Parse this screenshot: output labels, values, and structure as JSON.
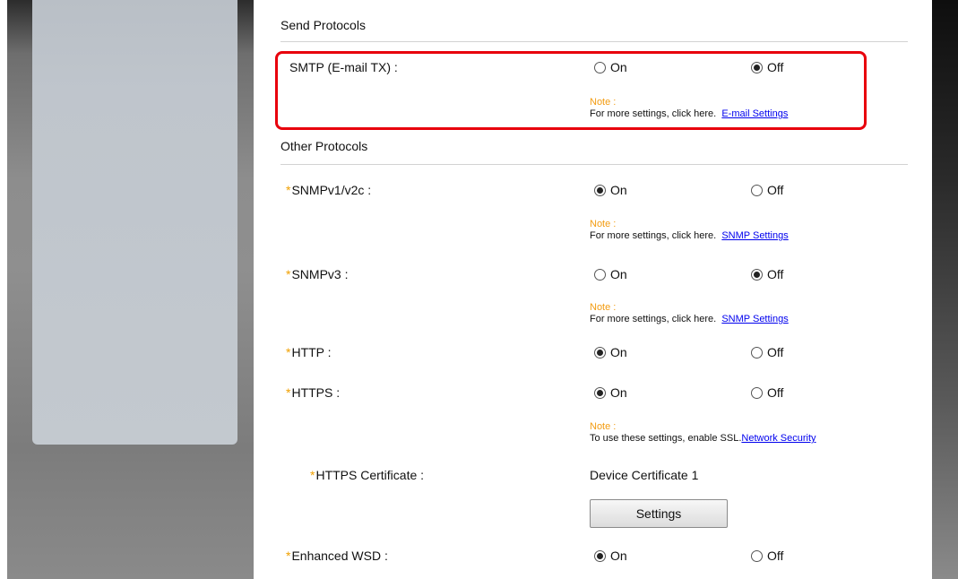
{
  "send_protocols": {
    "title": "Send Protocols",
    "smtp": {
      "label": "SMTP (E-mail TX) :",
      "on_label": "On",
      "off_label": "Off",
      "selected": "off",
      "note_title": "Note :",
      "note_text": "For more settings, click here.",
      "note_link": "E-mail Settings"
    }
  },
  "other_protocols": {
    "title": "Other Protocols",
    "required_mark": "*",
    "snmpv1": {
      "label": "SNMPv1/v2c :",
      "on_label": "On",
      "off_label": "Off",
      "selected": "on",
      "note_title": "Note :",
      "note_text": "For more settings, click here.",
      "note_link": "SNMP Settings"
    },
    "snmpv3": {
      "label": "SNMPv3 :",
      "on_label": "On",
      "off_label": "Off",
      "selected": "off",
      "note_title": "Note :",
      "note_text": "For more settings, click here.",
      "note_link": "SNMP Settings"
    },
    "http": {
      "label": "HTTP :",
      "on_label": "On",
      "off_label": "Off",
      "selected": "on"
    },
    "https": {
      "label": "HTTPS :",
      "on_label": "On",
      "off_label": "Off",
      "selected": "on",
      "note_title": "Note :",
      "note_text": "To use these settings, enable SSL.",
      "note_link": "Network Security"
    },
    "https_certificate": {
      "label": "HTTPS Certificate :",
      "value": "Device Certificate 1",
      "button_label": "Settings"
    },
    "enhanced_wsd": {
      "label": "Enhanced WSD :",
      "on_label": "On",
      "off_label": "Off",
      "selected": "on"
    }
  },
  "colors": {
    "required_mark": "#f0a000",
    "note_title": "#f39c12",
    "link": "#0000ee",
    "highlight_border": "#e8000c"
  }
}
